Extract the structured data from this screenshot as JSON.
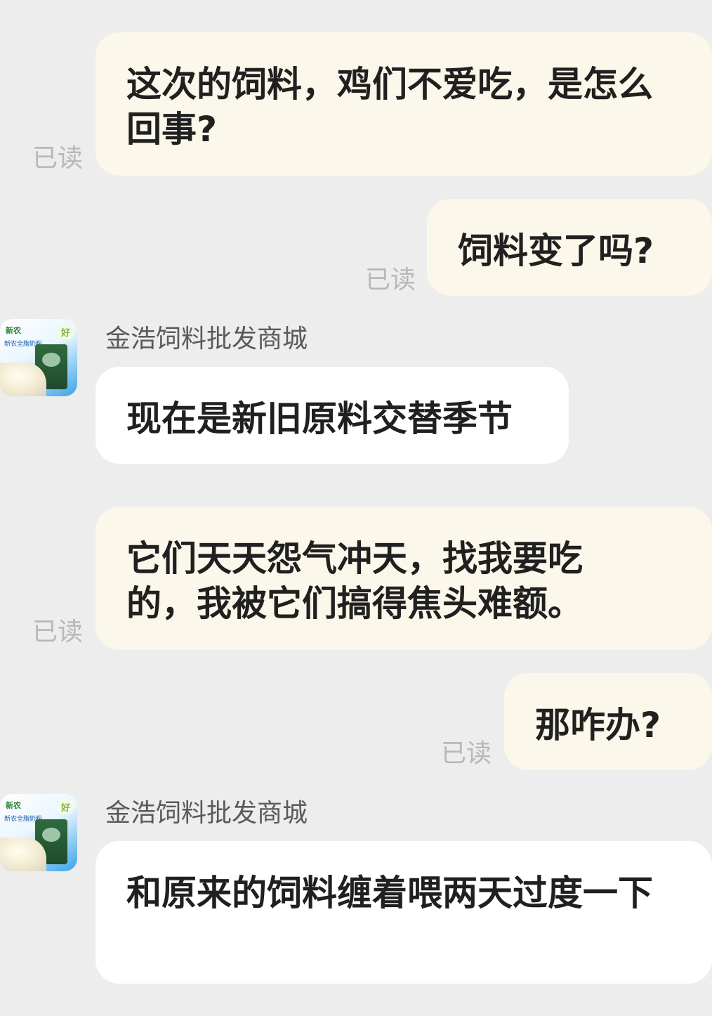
{
  "read_label": "已读",
  "sender_name": "金浩饲料批发商城",
  "avatar": {
    "logo_text": "新农",
    "tagline": "新农全脂奶粉",
    "badge": "好"
  },
  "messages": [
    {
      "id": "m1",
      "side": "out",
      "text": "这次的饲料，鸡们不爱吃，是怎么回事?",
      "status": "已读"
    },
    {
      "id": "m2",
      "side": "out",
      "text": "饲料变了吗?",
      "status": "已读"
    },
    {
      "id": "m3",
      "side": "in",
      "sender": "金浩饲料批发商城",
      "text": "现在是新旧原料交替季节"
    },
    {
      "id": "m4",
      "side": "out",
      "text": "它们天天怨气冲天，找我要吃的，我被它们搞得焦头难额。",
      "status": "已读"
    },
    {
      "id": "m5",
      "side": "out",
      "text": "那咋办?",
      "status": "已读"
    },
    {
      "id": "m6",
      "side": "in",
      "sender": "金浩饲料批发商城",
      "text": "和原来的饲料缠着喂两天过度一下"
    }
  ]
}
